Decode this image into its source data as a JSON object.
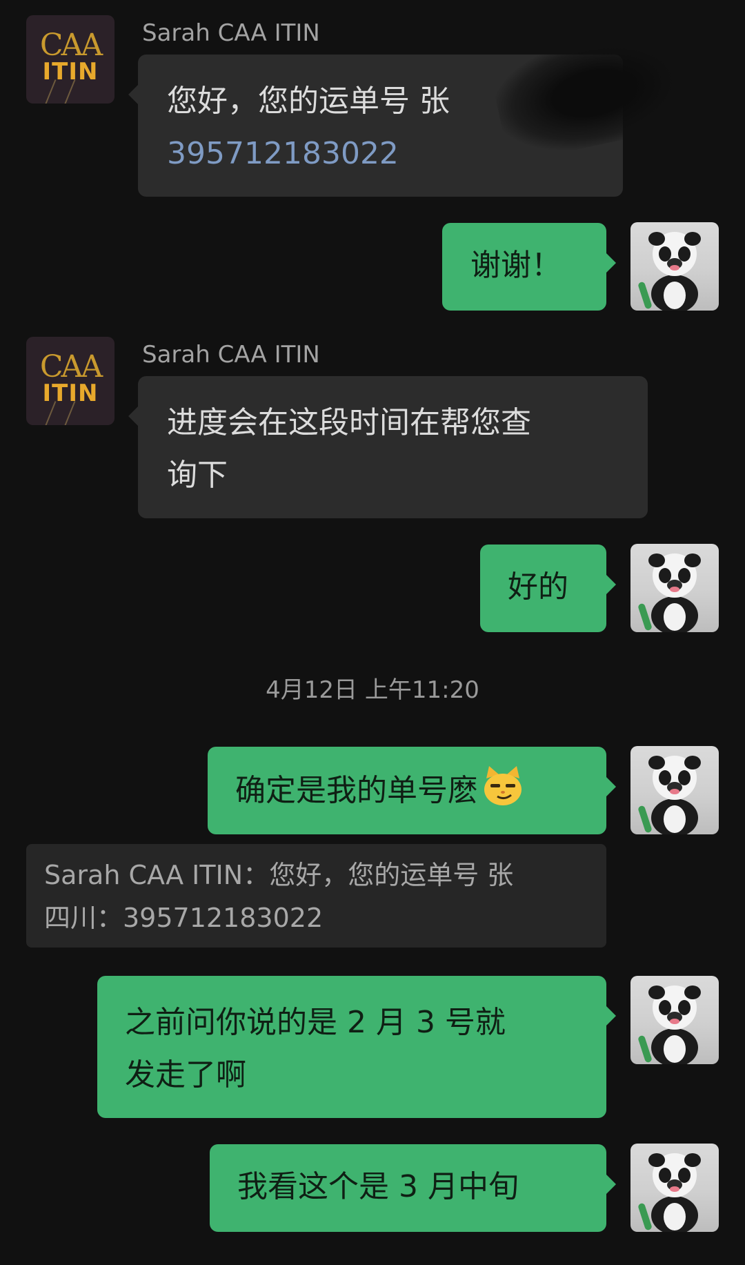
{
  "contact": {
    "name": "Sarah CAA ITIN",
    "avatar_logo_top": "CAA",
    "avatar_logo_bottom": "ITIN"
  },
  "messages": [
    {
      "direction": "incoming",
      "sender": "Sarah CAA ITIN",
      "text_line1": "您好，您的运单号 张",
      "text_line2": "395712183022"
    },
    {
      "direction": "outgoing",
      "text": "谢谢！"
    },
    {
      "direction": "incoming",
      "sender": "Sarah CAA ITIN",
      "text_line1": "进度会在这段时间在帮您查",
      "text_line2": "询下"
    },
    {
      "direction": "outgoing",
      "text": "好的"
    },
    {
      "direction": "outgoing",
      "text": "确定是我的单号麽",
      "emoji": "smirking-cat-emoji"
    },
    {
      "direction": "outgoing",
      "text_line1": "之前问你说的是 2 月 3 号就",
      "text_line2": "发走了啊"
    },
    {
      "direction": "outgoing",
      "text": "我看这个是 3 月中旬"
    }
  ],
  "timestamp": "4月12日 上午11:20",
  "quoted_reply": {
    "line1": "Sarah CAA ITIN：您好，您的运单号 张",
    "line2": "四川：395712183022"
  },
  "colors": {
    "background": "#111111",
    "incoming_bubble": "#2c2c2c",
    "outgoing_bubble": "#3fb36f",
    "link_number": "#7f9bc4"
  }
}
